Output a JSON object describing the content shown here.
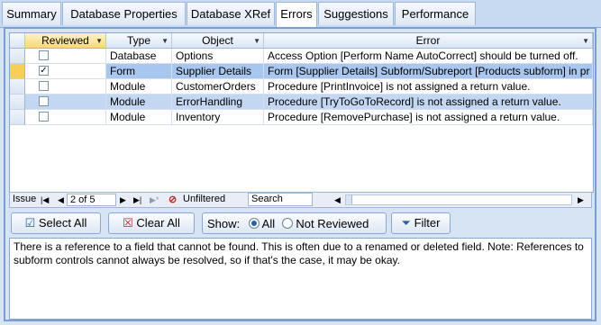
{
  "tabs": [
    "Summary",
    "Database Properties",
    "Database XRef",
    "Errors",
    "Suggestions",
    "Performance"
  ],
  "columns": {
    "reviewed": "Reviewed",
    "type": "Type",
    "object": "Object",
    "error": "Error"
  },
  "rows": [
    {
      "reviewed": false,
      "type": "Database",
      "object": "Options",
      "error": "Access Option [Perform Name AutoCorrect] should be turned off."
    },
    {
      "reviewed": true,
      "type": "Form",
      "object": "Supplier Details",
      "error": "Form [Supplier Details] Subform/Subreport [Products subform] in pr"
    },
    {
      "reviewed": false,
      "type": "Module",
      "object": "CustomerOrders",
      "error": "Procedure [PrintInvoice] is not assigned a return value."
    },
    {
      "reviewed": false,
      "type": "Module",
      "object": "ErrorHandling",
      "error": "Procedure [TryToGoToRecord] is not assigned a return value."
    },
    {
      "reviewed": false,
      "type": "Module",
      "object": "Inventory",
      "error": "Procedure [RemovePurchase] is not assigned a return value."
    }
  ],
  "nav": {
    "label": "Issue",
    "position": "2 of 5",
    "filter_status": "Unfiltered",
    "search_placeholder": "Search"
  },
  "toolbar": {
    "select_all": "Select All",
    "clear_all": "Clear All",
    "show_label": "Show:",
    "show_all": "All",
    "show_not_reviewed": "Not Reviewed",
    "filter": "Filter"
  },
  "message": "There is a reference to a field that cannot be found. This is often due to a renamed or deleted field. Note: References to subform controls cannot always be resolved, so if that's the case, it may be okay."
}
